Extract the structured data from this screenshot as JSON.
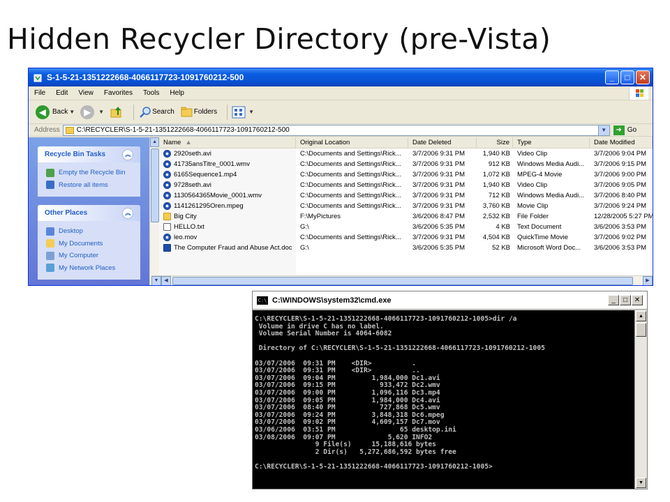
{
  "slide": {
    "title": "Hidden Recycler Directory (pre-Vista)"
  },
  "explorer": {
    "title": "S-1-5-21-1351222668-4066117723-1091760212-500",
    "menu": [
      "File",
      "Edit",
      "View",
      "Favorites",
      "Tools",
      "Help"
    ],
    "toolbar": {
      "back": "Back",
      "search": "Search",
      "folders": "Folders"
    },
    "address": {
      "label": "Address",
      "value": "C:\\RECYCLER\\S-1-5-21-1351222668-4066117723-1091760212-500",
      "go": "Go"
    },
    "tasks": {
      "title": "Recycle Bin Tasks",
      "items": [
        "Empty the Recycle Bin",
        "Restore all items"
      ]
    },
    "places": {
      "title": "Other Places",
      "items": [
        "Desktop",
        "My Documents",
        "My Computer",
        "My Network Places"
      ]
    },
    "columns": {
      "name": "Name",
      "location": "Original Location",
      "deleted": "Date Deleted",
      "size": "Size",
      "type": "Type",
      "modified": "Date Modified"
    },
    "files": [
      {
        "name": "2920seth.avi",
        "location": "C:\\Documents and Settings\\Rick...",
        "deleted": "3/7/2006 9:31 PM",
        "size": "1,940 KB",
        "type": "Video Clip",
        "modified": "3/7/2006 9:04 PM",
        "icon": "video-file-icon"
      },
      {
        "name": "41735ansTitre_0001.wmv",
        "location": "C:\\Documents and Settings\\Rick...",
        "deleted": "3/7/2006 9:31 PM",
        "size": "912 KB",
        "type": "Windows Media Audi...",
        "modified": "3/7/2006 9:15 PM",
        "icon": "video-file-icon"
      },
      {
        "name": "6165Sequence1.mp4",
        "location": "C:\\Documents and Settings\\Rick...",
        "deleted": "3/7/2006 9:31 PM",
        "size": "1,072 KB",
        "type": "MPEG-4 Movie",
        "modified": "3/7/2006 9:00 PM",
        "icon": "video-file-icon"
      },
      {
        "name": "9728seth.avi",
        "location": "C:\\Documents and Settings\\Rick...",
        "deleted": "3/7/2006 9:31 PM",
        "size": "1,940 KB",
        "type": "Video Clip",
        "modified": "3/7/2006 9:05 PM",
        "icon": "video-file-icon"
      },
      {
        "name": "1130564365Movie_0001.wmv",
        "location": "C:\\Documents and Settings\\Rick...",
        "deleted": "3/7/2006 9:31 PM",
        "size": "712 KB",
        "type": "Windows Media Audi...",
        "modified": "3/7/2006 8:40 PM",
        "icon": "video-file-icon"
      },
      {
        "name": "1141261295Oren.mpeg",
        "location": "C:\\Documents and Settings\\Rick...",
        "deleted": "3/7/2006 9:31 PM",
        "size": "3,760 KB",
        "type": "Movie Clip",
        "modified": "3/7/2006 9:24 PM",
        "icon": "video-file-icon"
      },
      {
        "name": "Big City",
        "location": "F:\\MyPictures",
        "deleted": "3/6/2006 8:47 PM",
        "size": "2,532 KB",
        "type": "File Folder",
        "modified": "12/28/2005 5:27 PM",
        "icon": "folder-icon"
      },
      {
        "name": "HELLO.txt",
        "location": "G:\\",
        "deleted": "3/6/2006 5:35 PM",
        "size": "4 KB",
        "type": "Text Document",
        "modified": "3/6/2006 3:53 PM",
        "icon": "text-file-icon"
      },
      {
        "name": "leo.mov",
        "location": "C:\\Documents and Settings\\Rick...",
        "deleted": "3/7/2006 9:31 PM",
        "size": "4,504 KB",
        "type": "QuickTime Movie",
        "modified": "3/7/2006 9:02 PM",
        "icon": "video-file-icon"
      },
      {
        "name": "The Computer Fraud and Abuse Act.doc",
        "location": "G:\\",
        "deleted": "3/6/2006 5:35 PM",
        "size": "52 KB",
        "type": "Microsoft Word Doc...",
        "modified": "3/6/2006 3:53 PM",
        "icon": "word-doc-icon"
      }
    ]
  },
  "cmd": {
    "title": "C:\\WINDOWS\\system32\\cmd.exe",
    "icon_text": "C:\\",
    "lines": [
      "C:\\RECYCLER\\S-1-5-21-1351222668-4066117723-1091760212-1005>dir /a",
      " Volume in drive C has no label.",
      " Volume Serial Number is 4064-6082",
      "",
      " Directory of C:\\RECYCLER\\S-1-5-21-1351222668-4066117723-1091760212-1005",
      "",
      "03/07/2006  09:31 PM    <DIR>          .",
      "03/07/2006  09:31 PM    <DIR>          ..",
      "03/07/2006  09:04 PM         1,984,000 Dc1.avi",
      "03/07/2006  09:15 PM           933,472 Dc2.wmv",
      "03/07/2006  09:00 PM         1,096,116 Dc3.mp4",
      "03/07/2006  09:05 PM         1,984,000 Dc4.avi",
      "03/07/2006  08:40 PM           727,868 Dc5.wmv",
      "03/07/2006  09:24 PM         3,848,318 Dc6.mpeg",
      "03/07/2006  09:02 PM         4,609,157 Dc7.mov",
      "03/06/2006  03:51 PM                65 desktop.ini",
      "03/08/2006  09:07 PM             5,620 INFO2",
      "               9 File(s)     15,188,616 bytes",
      "               2 Dir(s)   5,272,686,592 bytes free",
      "",
      "C:\\RECYCLER\\S-1-5-21-1351222668-4066117723-1091760212-1005>"
    ]
  }
}
